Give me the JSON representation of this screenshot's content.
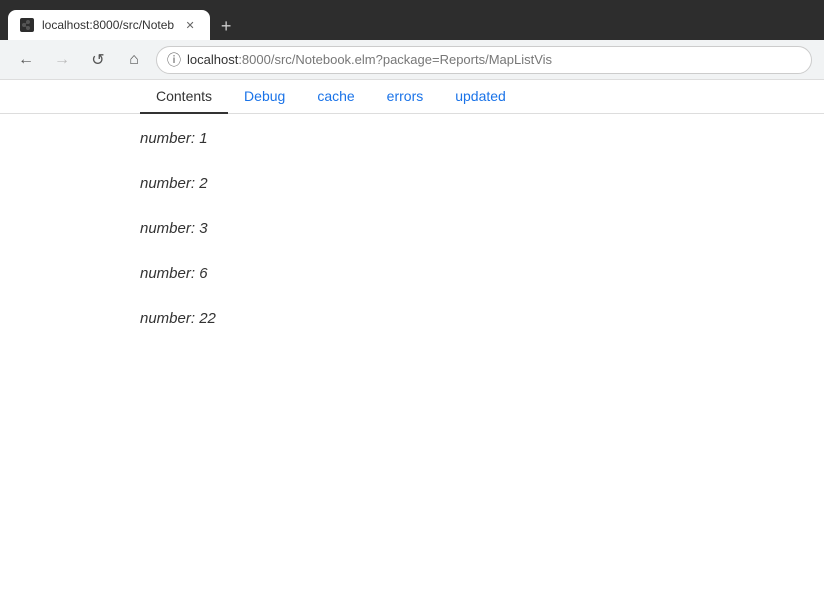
{
  "browser": {
    "tab_title": "localhost:8000/src/Noteb",
    "tab_favicon": "◼",
    "new_tab_label": "+",
    "address": "localhost:8000/src/Notebook.elm?package=Reports/MapListVis",
    "address_host": "localhost",
    "address_path": ":8000/src/Notebook.elm?package=Reports/MapListVis"
  },
  "nav": {
    "back_icon": "←",
    "forward_icon": "→",
    "reload_icon": "↺",
    "home_icon": "⌂",
    "info_icon": "ⓘ"
  },
  "page": {
    "tabs": [
      {
        "id": "contents",
        "label": "Contents",
        "active": true
      },
      {
        "id": "debug",
        "label": "Debug",
        "active": false
      },
      {
        "id": "cache",
        "label": "cache",
        "active": false
      },
      {
        "id": "errors",
        "label": "errors",
        "active": false
      },
      {
        "id": "updated",
        "label": "updated",
        "active": false
      }
    ],
    "numbers": [
      {
        "label": "number:",
        "value": "1"
      },
      {
        "label": "number:",
        "value": "2"
      },
      {
        "label": "number:",
        "value": "3"
      },
      {
        "label": "number:",
        "value": "6"
      },
      {
        "label": "number:",
        "value": "22"
      }
    ]
  }
}
